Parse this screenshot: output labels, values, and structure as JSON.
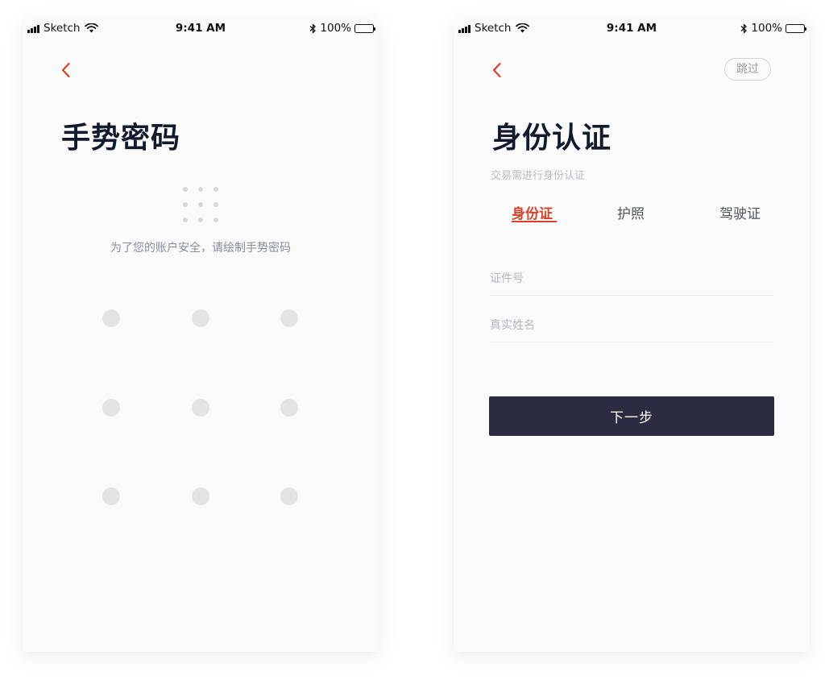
{
  "status_bar": {
    "carrier": "Sketch",
    "time": "9:41 AM",
    "battery": "100%"
  },
  "gesture_screen": {
    "title": "手势密码",
    "hint": "为了您的账户安全，请绘制手势密码"
  },
  "identity_screen": {
    "title": "身份认证",
    "skip_label": "跳过",
    "subtitle": "交易需进行身份认证",
    "tabs": [
      {
        "label": "身份证",
        "active": true
      },
      {
        "label": "护照",
        "active": false
      },
      {
        "label": "驾驶证",
        "active": false
      }
    ],
    "fields": {
      "id_number_placeholder": "证件号",
      "real_name_placeholder": "真实姓名"
    },
    "next_label": "下一步"
  },
  "colors": {
    "accent": "#d9402a",
    "button_dark": "#2b2c42",
    "title": "#141a2e"
  }
}
